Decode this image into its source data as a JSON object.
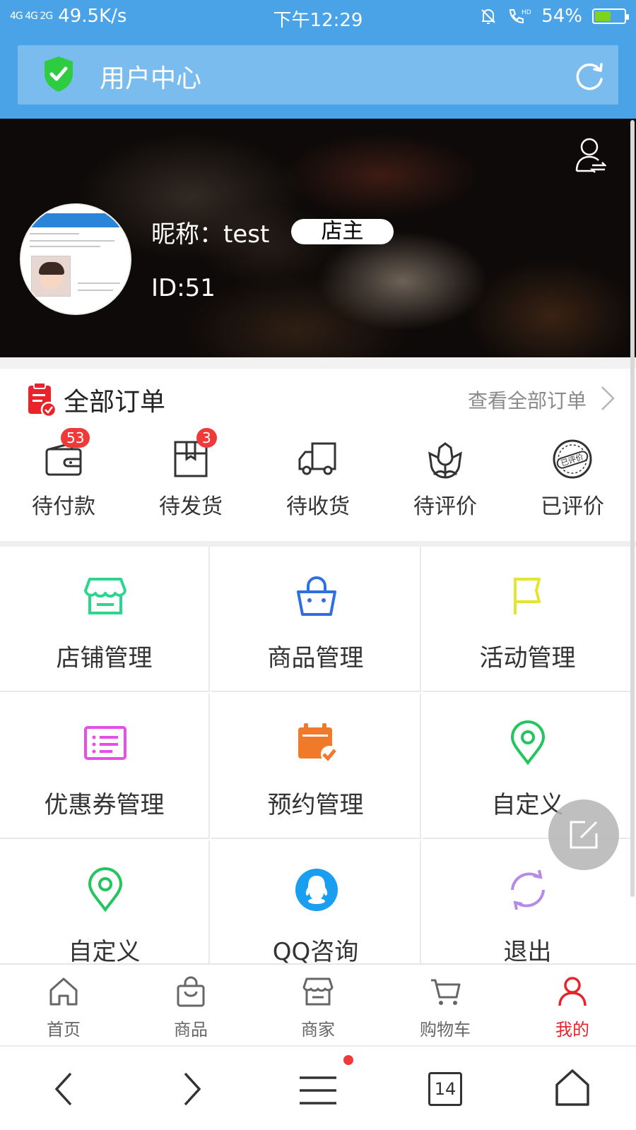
{
  "status_bar": {
    "network": "4G 4G 2G",
    "speed": "49.5K/s",
    "time": "下午12:29",
    "battery_percent": "54%",
    "battery_level": 0.54
  },
  "header": {
    "title": "用户中心",
    "shield_color": "#2ecc40"
  },
  "profile": {
    "nickname_label": "昵称：test",
    "role": "店主",
    "id_label": "ID:51"
  },
  "orders": {
    "title": "全部订单",
    "view_all": "查看全部订单",
    "items": [
      {
        "label": "待付款",
        "badge": "53",
        "icon": "wallet-icon"
      },
      {
        "label": "待发货",
        "badge": "3",
        "icon": "package-icon"
      },
      {
        "label": "待收货",
        "badge": "",
        "icon": "truck-icon"
      },
      {
        "label": "待评价",
        "badge": "",
        "icon": "flower-icon"
      },
      {
        "label": "已评价",
        "badge": "",
        "icon": "reviewed-stamp-icon"
      }
    ]
  },
  "grid": {
    "items": [
      {
        "label": "店铺管理",
        "icon": "store-icon",
        "color": "#2bd68d"
      },
      {
        "label": "商品管理",
        "icon": "shopping-bag-icon",
        "color": "#2f6fe0"
      },
      {
        "label": "活动管理",
        "icon": "flag-icon",
        "color": "#e3e62a"
      },
      {
        "label": "优惠券管理",
        "icon": "coupon-list-icon",
        "color": "#e64ee8"
      },
      {
        "label": "预约管理",
        "icon": "calendar-check-icon",
        "color": "#f07a2a"
      },
      {
        "label": "自定义",
        "icon": "location-pin-icon",
        "color": "#22c55e"
      },
      {
        "label": "自定义",
        "icon": "location-pin-icon",
        "color": "#22c55e"
      },
      {
        "label": "QQ咨询",
        "icon": "qq-icon",
        "color": "#1a9ef0"
      },
      {
        "label": "退出",
        "icon": "refresh-exit-icon",
        "color": "#b68ae8"
      }
    ]
  },
  "tabbar": {
    "items": [
      {
        "label": "首页",
        "icon": "home-icon",
        "active": false
      },
      {
        "label": "商品",
        "icon": "bag-icon",
        "active": false
      },
      {
        "label": "商家",
        "icon": "shop-icon",
        "active": false
      },
      {
        "label": "购物车",
        "icon": "cart-icon",
        "active": false
      },
      {
        "label": "我的",
        "icon": "user-icon",
        "active": true
      }
    ],
    "active_color": "#e8232a"
  },
  "browser": {
    "tab_count": "14"
  }
}
